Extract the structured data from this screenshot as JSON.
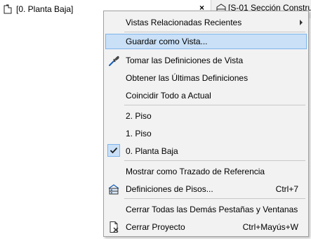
{
  "tabs": [
    {
      "label": "[0. Planta Baja]",
      "close": "×",
      "icon": "floor-plan-icon"
    },
    {
      "label": "[S-01 Sección Construc",
      "icon": "section-icon"
    }
  ],
  "menu": {
    "items": {
      "recent_views": "Vistas Relacionadas Recientes",
      "save_as_view": "Guardar como Vista...",
      "take_view_settings": "Tomar las Definiciones de Vista",
      "get_latest_settings": "Obtener las Últimas Definiciones",
      "match_all_current": "Coincidir Todo a Actual",
      "floor_2": "2. Piso",
      "floor_1": "1. Piso",
      "floor_0": "0. Planta Baja",
      "show_trace_reference": "Mostrar como Trazado de Referencia",
      "story_settings": "Definiciones de Pisos...",
      "story_settings_shortcut": "Ctrl+7",
      "close_other_tabs": "Cerrar Todas las Demás Pestañas y Ventanas",
      "close_project": "Cerrar Proyecto",
      "close_project_shortcut": "Ctrl+Mayús+W"
    },
    "icons": {
      "eyedropper": "eyedropper-icon",
      "story_settings": "story-settings-icon",
      "close_project": "close-project-icon",
      "check": "checkmark-icon"
    },
    "colors": {
      "highlight": "#c9e0f7",
      "highlight_border": "#7eb4ea",
      "background": "#f2f2f2"
    }
  }
}
